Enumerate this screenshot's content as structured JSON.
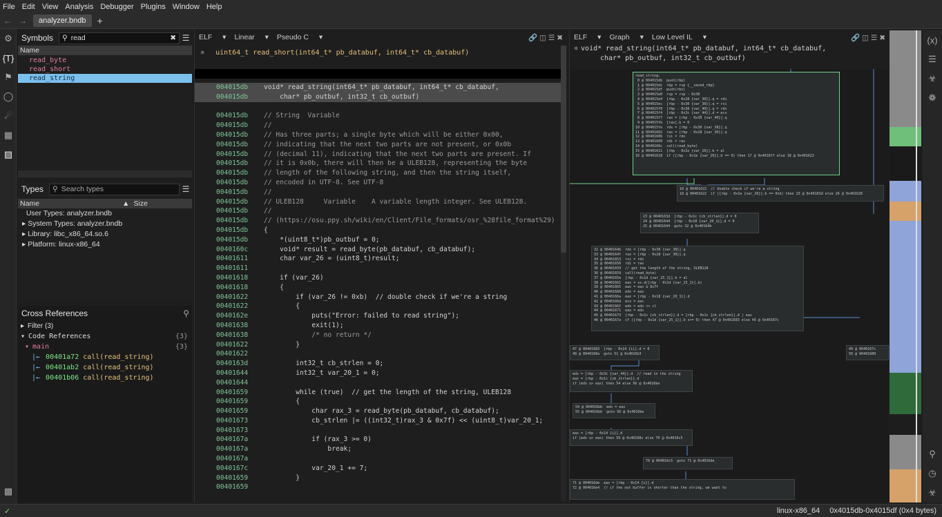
{
  "menu": [
    "File",
    "Edit",
    "View",
    "Analysis",
    "Debugger",
    "Plugins",
    "Window",
    "Help"
  ],
  "tab": {
    "filename": "analyzer.bndb",
    "add": "+"
  },
  "symbols": {
    "title": "Symbols",
    "search_value": "read",
    "column": "Name",
    "items": [
      "read_byte",
      "read_short",
      "read_string"
    ],
    "selected": "read_string"
  },
  "types": {
    "title": "Types",
    "search_placeholder": "Search types",
    "col_name": "Name",
    "col_size": "Size",
    "items": [
      "User Types: analyzer.bndb",
      "System Types: analyzer.bndb",
      "Library: libc_x86_64.so.6",
      "Platform: linux-x86_64"
    ]
  },
  "xrefs": {
    "title": "Cross References",
    "filter": "Filter (3)",
    "code_refs": "Code References",
    "code_refs_count": "{3}",
    "group": "main",
    "group_count": "{3}",
    "refs": [
      {
        "addr": "00401a72",
        "text": "call(read_string)"
      },
      {
        "addr": "00401ab2",
        "text": "call(read_string)"
      },
      {
        "addr": "00401b06",
        "text": "call(read_string)"
      }
    ]
  },
  "pseudo_pane": {
    "view": "ELF",
    "layout": "Linear",
    "lang": "Pseudo C",
    "header_sig": "uint64_t read_short(int64_t* pb_databuf, int64_t* cb_databuf)",
    "lines": [
      {
        "addr": "004015db",
        "text": "void* read_string(int64_t* pb_databuf, int64_t* cb_databuf,",
        "hl": true
      },
      {
        "addr": "004015db",
        "text": "    char* pb_outbuf, int32_t cb_outbuf)",
        "hl": true
      },
      {
        "addr": "",
        "text": ""
      },
      {
        "addr": "004015db",
        "text": "// String  Variable"
      },
      {
        "addr": "004015db",
        "text": "//"
      },
      {
        "addr": "004015db",
        "text": "// Has three parts; a single byte which will be either 0x00,"
      },
      {
        "addr": "004015db",
        "text": "// indicating that the next two parts are not present, or 0x0b"
      },
      {
        "addr": "004015db",
        "text": "// (decimal 11), indicating that the next two parts are present. If"
      },
      {
        "addr": "004015db",
        "text": "// it is 0x0b, there will then be a ULEB128, representing the byte"
      },
      {
        "addr": "004015db",
        "text": "// length of the following string, and then the string itself,"
      },
      {
        "addr": "004015db",
        "text": "// encoded in UTF-8. See UTF-8"
      },
      {
        "addr": "004015db",
        "text": "//"
      },
      {
        "addr": "004015db",
        "text": "// ULEB128     Variable    A variable length integer. See ULEB128."
      },
      {
        "addr": "004015db",
        "text": "//"
      },
      {
        "addr": "004015db",
        "text": "// (https://osu.ppy.sh/wiki/en/Client/File_formats/osr_%28file_format%29)"
      },
      {
        "addr": "004015db",
        "text": "{"
      },
      {
        "addr": "004015db",
        "text": "    *(uint8_t*)pb_outbuf = 0;"
      },
      {
        "addr": "0040160c",
        "text": "    void* result = read_byte(pb_databuf, cb_databuf);"
      },
      {
        "addr": "00401611",
        "text": "    char var_26 = (uint8_t)result;"
      },
      {
        "addr": "00401611",
        "text": ""
      },
      {
        "addr": "00401618",
        "text": "    if (var_26)"
      },
      {
        "addr": "00401618",
        "text": "    {"
      },
      {
        "addr": "00401622",
        "text": "        if (var_26 != 0xb)  // double check if we're a string"
      },
      {
        "addr": "00401622",
        "text": "        {"
      },
      {
        "addr": "0040162e",
        "text": "            puts(\"Error: failed to read string\");"
      },
      {
        "addr": "00401638",
        "text": "            exit(1);"
      },
      {
        "addr": "00401638",
        "text": "            /* no return */"
      },
      {
        "addr": "00401622",
        "text": "        }"
      },
      {
        "addr": "00401622",
        "text": ""
      },
      {
        "addr": "0040163d",
        "text": "        int32_t cb_strlen = 0;"
      },
      {
        "addr": "00401644",
        "text": "        int32_t var_20_1 = 0;"
      },
      {
        "addr": "00401644",
        "text": ""
      },
      {
        "addr": "00401659",
        "text": "        while (true)  // get the length of the string, ULEB128"
      },
      {
        "addr": "00401659",
        "text": "        {"
      },
      {
        "addr": "00401659",
        "text": "            char rax_3 = read_byte(pb_databuf, cb_databuf);"
      },
      {
        "addr": "00401673",
        "text": "            cb_strlen |= ((int32_t)rax_3 & 0x7f) << (uint8_t)var_20_1;"
      },
      {
        "addr": "00401673",
        "text": ""
      },
      {
        "addr": "0040167a",
        "text": "            if (rax_3 >= 0)"
      },
      {
        "addr": "0040167a",
        "text": "                break;"
      },
      {
        "addr": "0040167a",
        "text": ""
      },
      {
        "addr": "0040167c",
        "text": "            var_20_1 += 7;"
      },
      {
        "addr": "00401659",
        "text": "        }"
      },
      {
        "addr": "00401659",
        "text": ""
      }
    ]
  },
  "graph_pane": {
    "view": "ELF",
    "layout": "Graph",
    "il": "Low Level IL",
    "sig_line1": "void* read_string(int64_t* pb_databuf, int64_t* cb_databuf,",
    "sig_line2": "    char* pb_outbuf, int32_t cb_outbuf)",
    "blocks": [
      {
        "id": "entry",
        "text": "read_string:\n 0 @ 004015db  push(rbp)\n 1 @ 004015dc  rbp = rsp {__saved_rbp}\n 2 @ 004015df  push(rbx)\n 3 @ 004015e0  rsp = rsp - 0x38\n 4 @ 004015e4  [rbp - 0x28 {var_30}].q = rdi\n 5 @ 004015ec  [rbp - 0x30 {var_38}].q = rsi\n 6 @ 004015f0  [rbp - 0x38 {var_40}].q = rdx\n 7 @ 004015f4  [rbp - 0x3c {var_44}].d = ecx\n 8 @ 004015f7  rax = [rbp - 0x38 {var_40}].q\n 9 @ 004015fb  [rax].b = 0\n10 @ 004015fe  rdx = [rbp - 0x30 {var_38}].q\n11 @ 00401602  rax = [rbp - 0x28 {var_30}].q\n12 @ 00401606  rsi = rdx\n13 @ 00401609  rdi = rax\n14 @ 0040160c  call(read_byte)\n15 @ 00401611  [rbp - 0x1e {var_26}].b = al\n16 @ 00401618  if ([rbp - 0x1e {var_26}].b == 0) then 17 @ 0x4016ff else 18 @ 0x401622"
      },
      {
        "id": "b18",
        "text": "18 @ 00401622  // double check if we're a string\n18 @ 00401622  if ([rbp - 0x1e {var_26}].b == 0xb) then 23 @ 0x40163d else 26 @ 0x401628"
      },
      {
        "id": "b23",
        "text": "23 @ 0040163d  [rbp - 0x1c {cb_strlen}].d = 0\n24 @ 00401644  [rbp - 0x18 {var_20_1}].d = 0\n25 @ 00401644  goto 32 @ 0x40164b"
      },
      {
        "id": "b32",
        "text": "32 @ 0040164b  rdx = [rbp - 0x30 {var_38}].q\n33 @ 0040164f  rax = [rbp - 0x28 {var_30}].q\n34 @ 00401653  rsi = rdx\n35 @ 00401656  rdi = rax\n36 @ 00401659  // get the length of the string, ULEB128\n36 @ 00401659  call(read_byte)\n37 @ 0040165e  [rbp - 0x1d {var_25_1}].b = al\n38 @ 00401661  eax = sx.d([rbp - 0x1d {var_25_1}].b)\n39 @ 00401665  eax = eax & 0x7f\n40 @ 00401668  edx = eax\n41 @ 0040166a  eax = [rbp - 0x18 {var_20_1}].d\n42 @ 0040166d  ecx = eax\n43 @ 0040166f  edx = edx << cl\n44 @ 00401671  eax = edx\n45 @ 00401673  [rbp - 0x1c {cb_strlen}].d = [rbp - 0x1c {cb_strlen}].d | eax\n46 @ 0040167a  if ([rbp - 0x1d {var_25_1}].b s>= 0) then 47 @ 0x401683 else 49 @ 0x40167c"
      },
      {
        "id": "b47",
        "text": "47 @ 00401683  [rbp - 0x14 {i}].d = 0\n48 @ 0040168a  goto 51 @ 0x4016b3"
      },
      {
        "id": "b49",
        "text": "49 @ 0040167c\n50 @ 00401680"
      },
      {
        "id": "b51",
        "text": "edx = [rbp - 0x3c {var_44}].d  // read in the string\neax = [rbp - 0x1c {cb_strlen}].d\nif (edx u> eax) then 54 else 56 @ 0x4016be"
      },
      {
        "id": "b54",
        "text": "54 @ 004016bb  edx = eax\n55 @ 004016bb  goto 56 @ 0x4016be"
      },
      {
        "id": "b56",
        "text": "eax = [rbp - 0x14 {i}].d\nif (edx u> eax) then 59 @ 0x40168c else 70 @ 0x4016c5"
      },
      {
        "id": "b70",
        "text": "70 @ 004016c5  goto 71 @ 0x4016de"
      },
      {
        "id": "b71",
        "text": "71 @ 004016de  eax = [rbp - 0x14 {i}].d\n72 @ 004016e4  // if the out buffer is shorter than the string, we want to"
      }
    ]
  },
  "status": {
    "arch": "linux-x86_64",
    "range": "0x4015db-0x4015df (0x4 bytes)"
  },
  "colors": {
    "accent": "#7cc0ec",
    "address_green": "#7ec699",
    "symbol_pink": "#e07ba0",
    "graph_entry_border": "#6fd18a",
    "edge_blue": "#5a8fd6"
  }
}
